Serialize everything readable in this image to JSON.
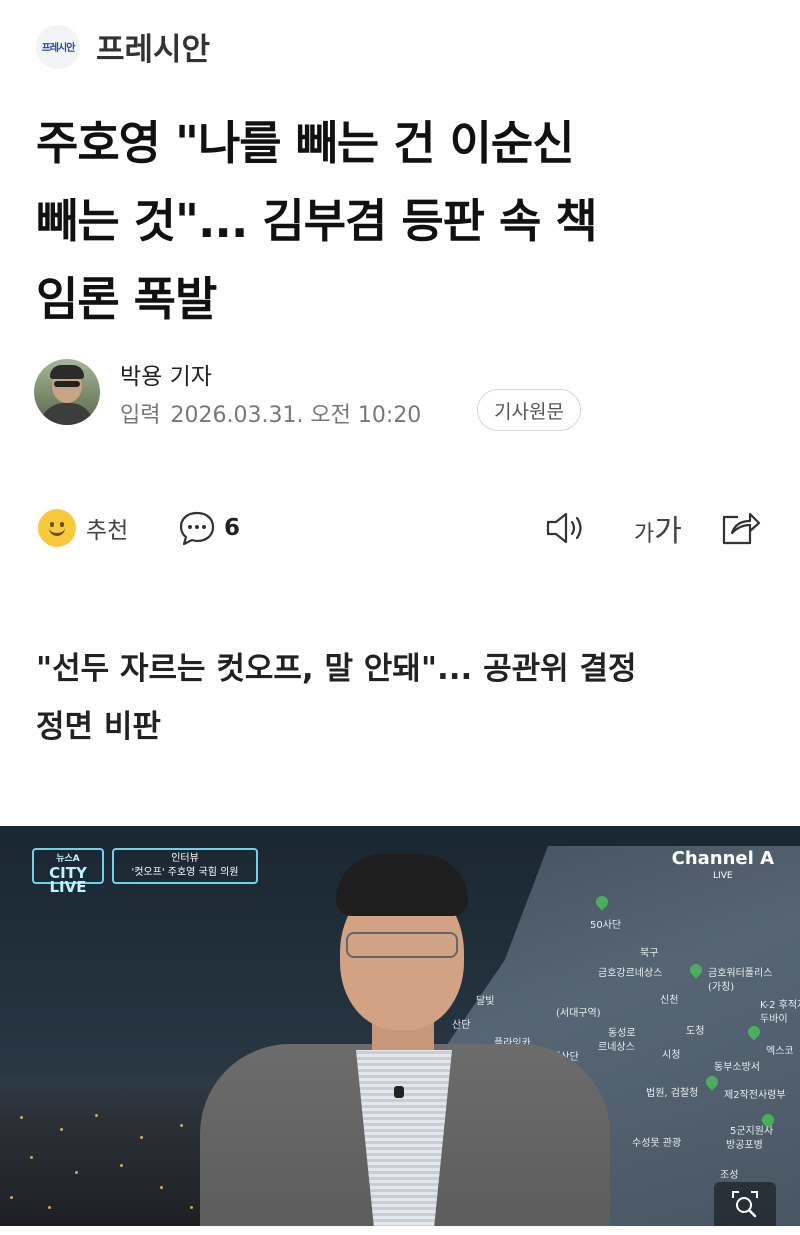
{
  "publisher": {
    "logo_text": "프레시안",
    "name": "프레시안"
  },
  "article": {
    "headline_lines": [
      "주호영 \"나를 빼는 건 이순신",
      "빼는 것\"... 김부겸 등판 속 책",
      "임론 폭발"
    ],
    "reporter": "박용 기자",
    "date_label": "입력",
    "date": "2026.03.31. 오전 10:20",
    "original_button": "기사원문",
    "subhead_lines": [
      "\"선두 자르는 컷오프, 말 안돼\"... 공관위 결정",
      "정면 비판"
    ]
  },
  "toolbar": {
    "recommend_label": "추천",
    "comment_count": "6",
    "font_small": "가",
    "font_big": "가",
    "icons": [
      "smile-icon",
      "comment-icon",
      "speaker-icon",
      "font-size-icon",
      "share-icon"
    ]
  },
  "video": {
    "badge_top": "뉴스A",
    "badge_main": "CITY LIVE",
    "caption_line1": "인터뷰",
    "caption_line2": "'컷오프' 주호영 국힘 의원",
    "channel": "Channel A",
    "channel_live": "LIVE",
    "map_labels": [
      "50사단",
      "북구",
      "금호강르네상스",
      "금호워터폴리스",
      "(가칭)",
      "신천",
      "달빛",
      "(서대구역)",
      "동성로",
      "르네상스",
      "시청",
      "동부소방서",
      "엑스코",
      "도청",
      "법원, 검찰청",
      "산단",
      "플라잉카",
      "염색산단",
      "K-2 후적지",
      "두바이",
      "제2작전사령부",
      "5군지원사",
      "방공포병",
      "수성못 관광",
      "조성"
    ]
  },
  "colors": {
    "accent_outline": "#6fd3e8",
    "smile": "#f8c93a"
  }
}
